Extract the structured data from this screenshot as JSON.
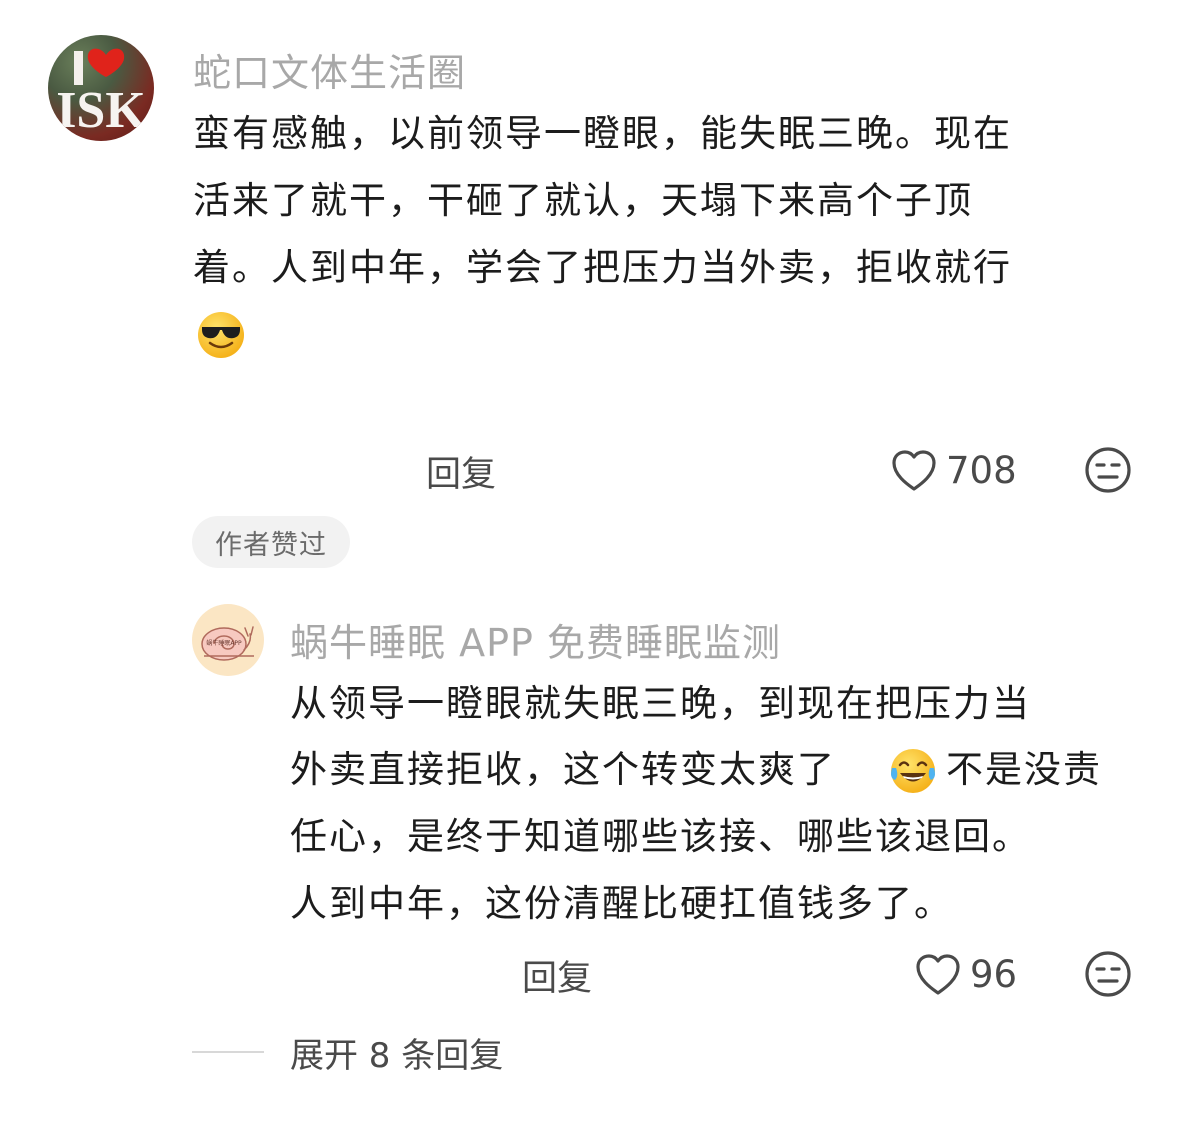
{
  "comment1": {
    "username": "蛇口文体生活圈",
    "avatar_text": "ISK",
    "lines": [
      "蛮有感触，以前领导一瞪眼，能失眠三晚。现在",
      "活来了就干，干砸了就认，天塌下来高个子顶",
      "着。人到中年，学会了把压力当外卖，拒收就行"
    ],
    "emoji": "smiling-face-with-sunglasses",
    "reply_label": "回复",
    "like_count": "708",
    "badge": "作者赞过"
  },
  "reply1": {
    "username": "蜗牛睡眠 APP 免费睡眠监测",
    "avatar_text": "蜗牛睡眠APP",
    "lines": [
      "从领导一瞪眼就失眠三晚，到现在把压力当",
      "外卖直接拒收，这个转变太爽了",
      "不是没责",
      "任心，是终于知道哪些该接、哪些该退回。",
      "人到中年，这份清醒比硬扛值钱多了。"
    ],
    "emoji": "face-with-tears-of-joy",
    "reply_label": "回复",
    "like_count": "96"
  },
  "expand": {
    "label": "展开 8 条回复"
  },
  "colors": {
    "username": "#a8a8a8",
    "body": "#1c1c1c",
    "action": "#4a4a4a",
    "badge_bg": "#f2f2f2",
    "badge_text": "#6b6b6b"
  }
}
